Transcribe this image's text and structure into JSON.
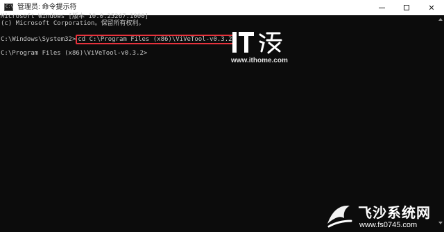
{
  "window": {
    "icon_text": "C:\\",
    "title": "管理员: 命令提示符"
  },
  "controls": {
    "close_glyph": "✕"
  },
  "console": {
    "lines": [
      "Microsoft Windows [版本 10.0.25267.1000]",
      "(c) Microsoft Corporation。保留所有权利。",
      "",
      "C:\\Program Files (x86)\\ViVeTool-v0.3.2>"
    ],
    "prompt": "C:\\Windows\\System32>",
    "command": "cd C:\\Program Files (x86)\\ViVeTool-v0.3.2"
  },
  "watermarks": {
    "ithome_url": "www.ithome.com",
    "site_name": "飞沙系统网",
    "site_url": "www.fs0745.com"
  },
  "colors": {
    "console_bg": "#0c0c0c",
    "console_text": "#c8c8c8",
    "highlight_border": "#e8323c",
    "titlebar_bg": "#ffffff"
  }
}
